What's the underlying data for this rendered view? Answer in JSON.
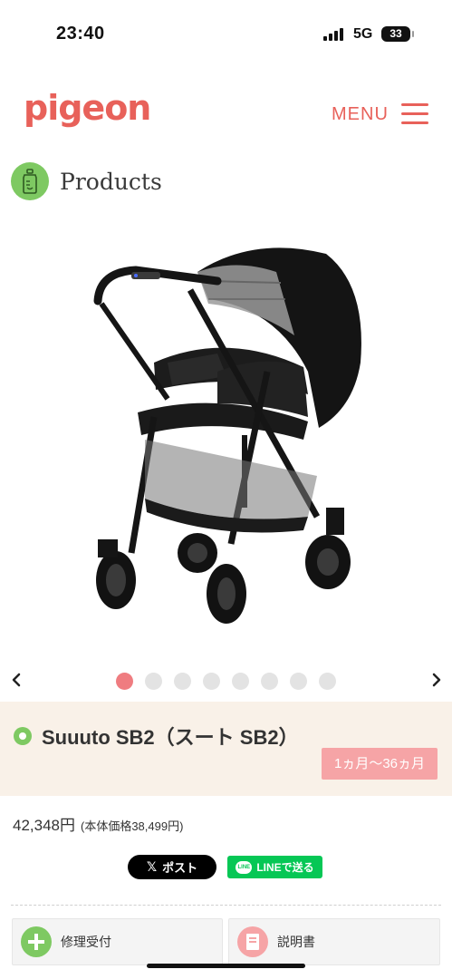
{
  "status_bar": {
    "time": "23:40",
    "network": "5G",
    "battery": "33"
  },
  "header": {
    "logo_text": "pigeon",
    "menu_label": "MENU",
    "brand_color": "#e8615a"
  },
  "section": {
    "title": "Products",
    "icon": "baby-bottle-icon"
  },
  "carousel": {
    "slide_count": 8,
    "active_index": 0,
    "active_color": "#ef7c80",
    "inactive_color": "#e3e3e3"
  },
  "product": {
    "name": "Suuuto SB2（スート SB2）",
    "age_range": "1ヵ月〜36ヵ月",
    "price": "42,348円",
    "price_note": "(本体価格38,499円)"
  },
  "share": {
    "x_label": "ポスト",
    "line_label": "LINEで送る"
  },
  "actions": {
    "repair_label": "修理受付",
    "manual_label": "説明書"
  }
}
